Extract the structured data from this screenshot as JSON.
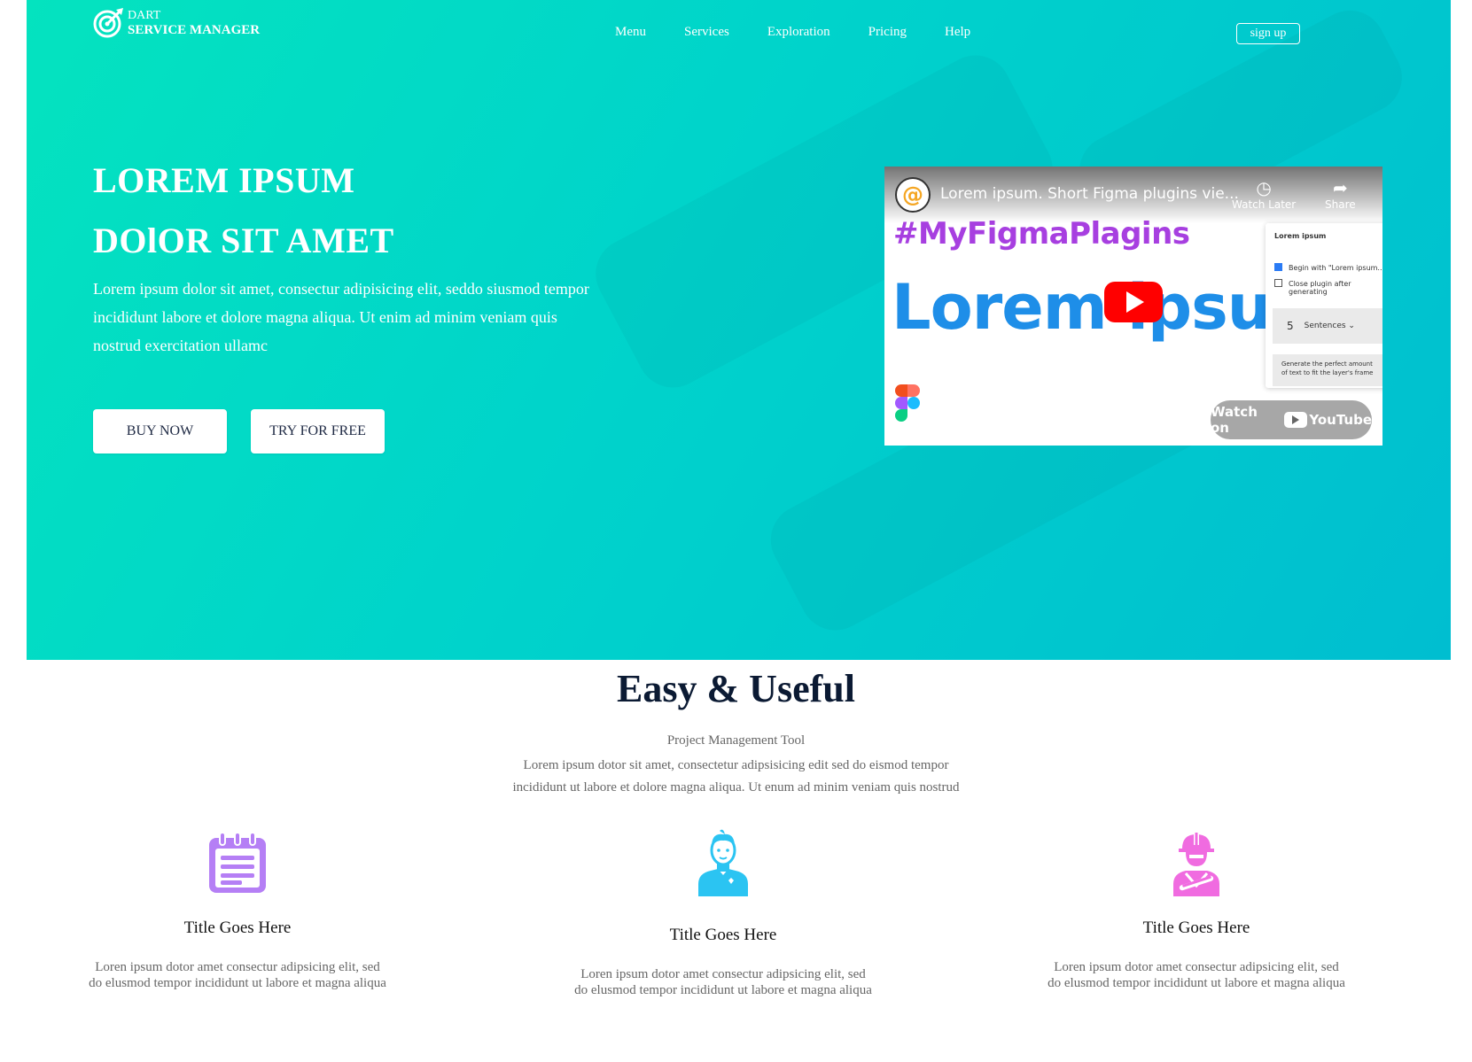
{
  "brand": {
    "line1": "DART",
    "line2": "SERVICE MANAGER"
  },
  "nav": {
    "items": [
      "Menu",
      "Services",
      "Exploration",
      "Pricing",
      "Help"
    ],
    "signup": "sign up"
  },
  "hero": {
    "title1": "LOREM IPSUM",
    "title2": "DOlOR SIT AMET",
    "description": "Lorem ipsum dolor sit amet, consectur adipisicing elit, seddo siusmod tempor incididunt labore et dolore magna aliqua. Ut enim ad minim veniam quis nostrud exercitation ullamc",
    "buy_label": "BUY NOW",
    "try_label": "TRY FOR FREE"
  },
  "video": {
    "title": "Lorem ipsum. Short Figma plugins vie...",
    "watch_later": "Watch Later",
    "share": "Share",
    "hashtag": "#MyFigmaPlagins",
    "big_text": "Lorem ipsum",
    "panel_title": "Lorem ipsum",
    "option1": "Begin with \"Lorem ipsum...\"",
    "option2": "Close plugin after generating",
    "sentences_num": "5",
    "sentences_label": "Sentences ⌄",
    "generate_text": "Generate the perfect amount of text to fit the layer's frame",
    "watch_on": "Watch on",
    "youtube": "YouTube"
  },
  "features": {
    "title": "Easy & Useful",
    "subtitle": "Project Management Tool",
    "description": "Lorem ipsum dotor sit amet, consectetur adipsisicing edit sed do eismod tempor incididunt ut labore et dolore magna aliqua. Ut enum ad minim veniam quis nostrud",
    "items": [
      {
        "title": "Title Goes Here",
        "desc": "Loren ipsum dotor amet consectur adipsicing elit, sed do elusmod tempor incididunt ut labore et magna aliqua",
        "icon": "calendar-icon",
        "color": "#b57ff5"
      },
      {
        "title": "Title Goes Here",
        "desc": "Loren ipsum dotor amet consectur adipsicing elit, sed do elusmod tempor incididunt ut labore et magna aliqua",
        "icon": "person-icon",
        "color": "#2bc4f2"
      },
      {
        "title": "Title Goes Here",
        "desc": "Loren ipsum dotor amet consectur adipsicing elit, sed do elusmod tempor incididunt ut labore et magna aliqua",
        "icon": "engineer-icon",
        "color": "#f06be0"
      }
    ]
  },
  "colors": {
    "hero_start": "#04e3bf",
    "hero_end": "#00bed0",
    "heading": "#0b1a33",
    "youtube_red": "#ff0000"
  }
}
